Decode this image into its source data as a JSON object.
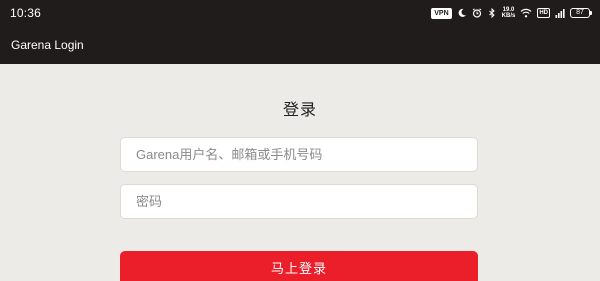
{
  "status_bar": {
    "time": "10:36",
    "vpn": "VPN",
    "speed_value": "19.0",
    "speed_unit": "KB/s",
    "hd": "HD",
    "battery": "87"
  },
  "app_bar": {
    "title": "Garena Login"
  },
  "login": {
    "heading": "登录",
    "username_placeholder": "Garena用户名、邮箱或手机号码",
    "password_placeholder": "密码",
    "submit_label": "马上登录"
  },
  "colors": {
    "bar_background": "#201c1b",
    "page_background": "#ecebe7",
    "button_red": "#ea1f2a"
  },
  "icons": [
    "moon-icon",
    "alarm-icon",
    "bluetooth-icon",
    "wifi-icon",
    "signal-icon"
  ]
}
